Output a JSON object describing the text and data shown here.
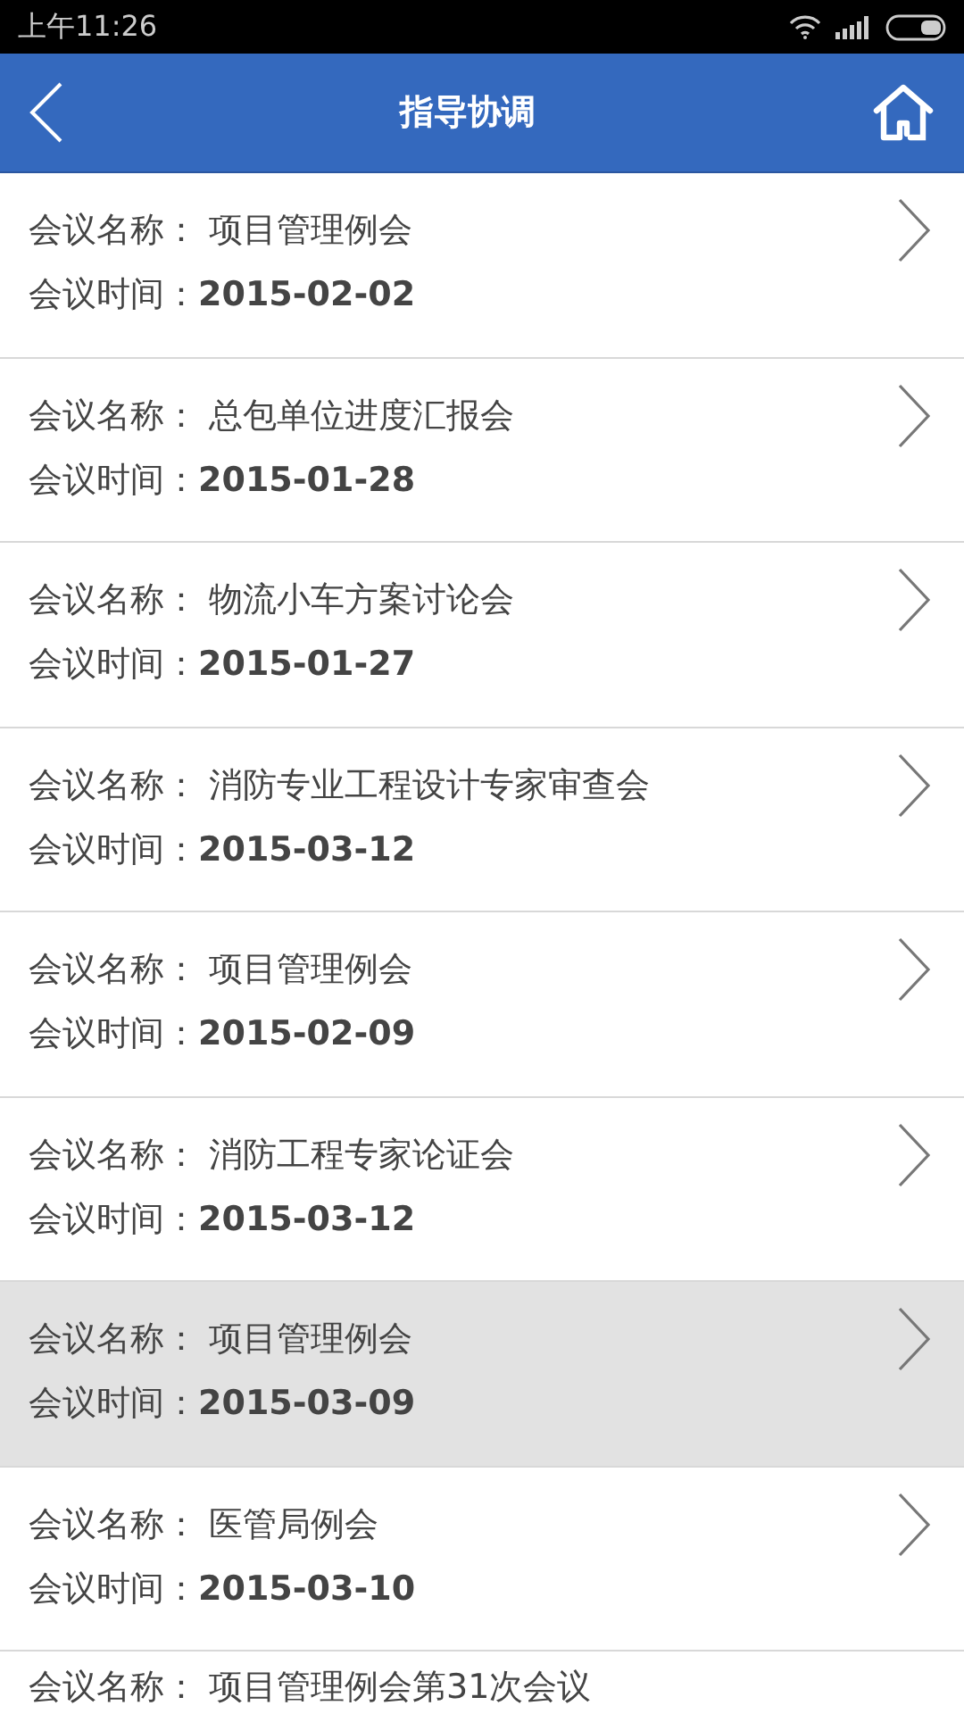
{
  "status_bar": {
    "time": "上午11:26"
  },
  "header": {
    "title": "指导协调"
  },
  "meetings": [
    {
      "name_label": "会议名称：",
      "name": "项目管理例会",
      "time_label": "会议时间：",
      "time": "2015-02-02",
      "selected": false
    },
    {
      "name_label": "会议名称：",
      "name": "总包单位进度汇报会",
      "time_label": "会议时间：",
      "time": "2015-01-28",
      "selected": false
    },
    {
      "name_label": "会议名称：",
      "name": "物流小车方案讨论会",
      "time_label": "会议时间：",
      "time": "2015-01-27",
      "selected": false
    },
    {
      "name_label": "会议名称：",
      "name": "消防专业工程设计专家审查会",
      "time_label": "会议时间：",
      "time": "2015-03-12",
      "selected": false
    },
    {
      "name_label": "会议名称：",
      "name": "项目管理例会",
      "time_label": "会议时间：",
      "time": "2015-02-09",
      "selected": false
    },
    {
      "name_label": "会议名称：",
      "name": "消防工程专家论证会",
      "time_label": "会议时间：",
      "time": "2015-03-12",
      "selected": false
    },
    {
      "name_label": "会议名称：",
      "name": "项目管理例会",
      "time_label": "会议时间：",
      "time": "2015-03-09",
      "selected": true
    },
    {
      "name_label": "会议名称：",
      "name": "医管局例会",
      "time_label": "会议时间：",
      "time": "2015-03-10",
      "selected": false
    },
    {
      "name_label": "会议名称：",
      "name": "项目管理例会第31次会议",
      "selected": false
    }
  ]
}
